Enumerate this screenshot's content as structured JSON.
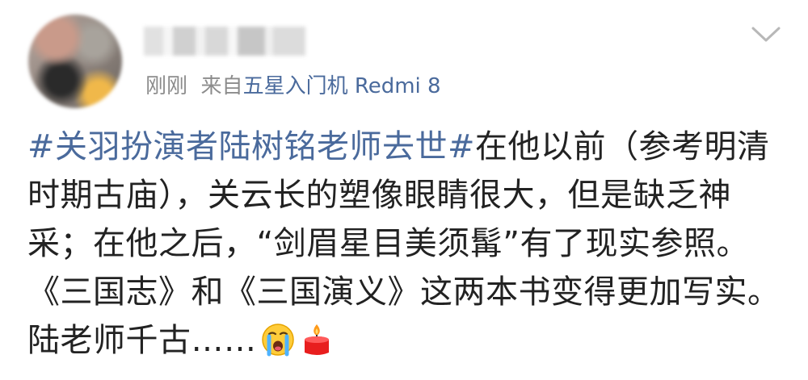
{
  "header": {
    "meta_time": "刚刚",
    "meta_source_prefix": "来自",
    "meta_device": "五星入门机 Redmi 8"
  },
  "post": {
    "topic": "#关羽扮演者陆树铭老师去世#",
    "body": "在他以前（参考明清时期古庙），关云长的塑像眼睛很大，但是缺乏神采；在他之后，“剑眉星目美须髯”有了现实参照。《三国志》和《三国演义》这两本书变得更加写实。陆老师千古……"
  },
  "icons": {
    "avatar": "blurred-avatar",
    "username": "blurred-username",
    "menu": "chevron-down-icon",
    "emoji1": "crying-face-icon",
    "emoji2": "candle-icon"
  },
  "colors": {
    "link": "#4a6a9c",
    "meta": "#8c8c8c",
    "text": "#222222"
  }
}
